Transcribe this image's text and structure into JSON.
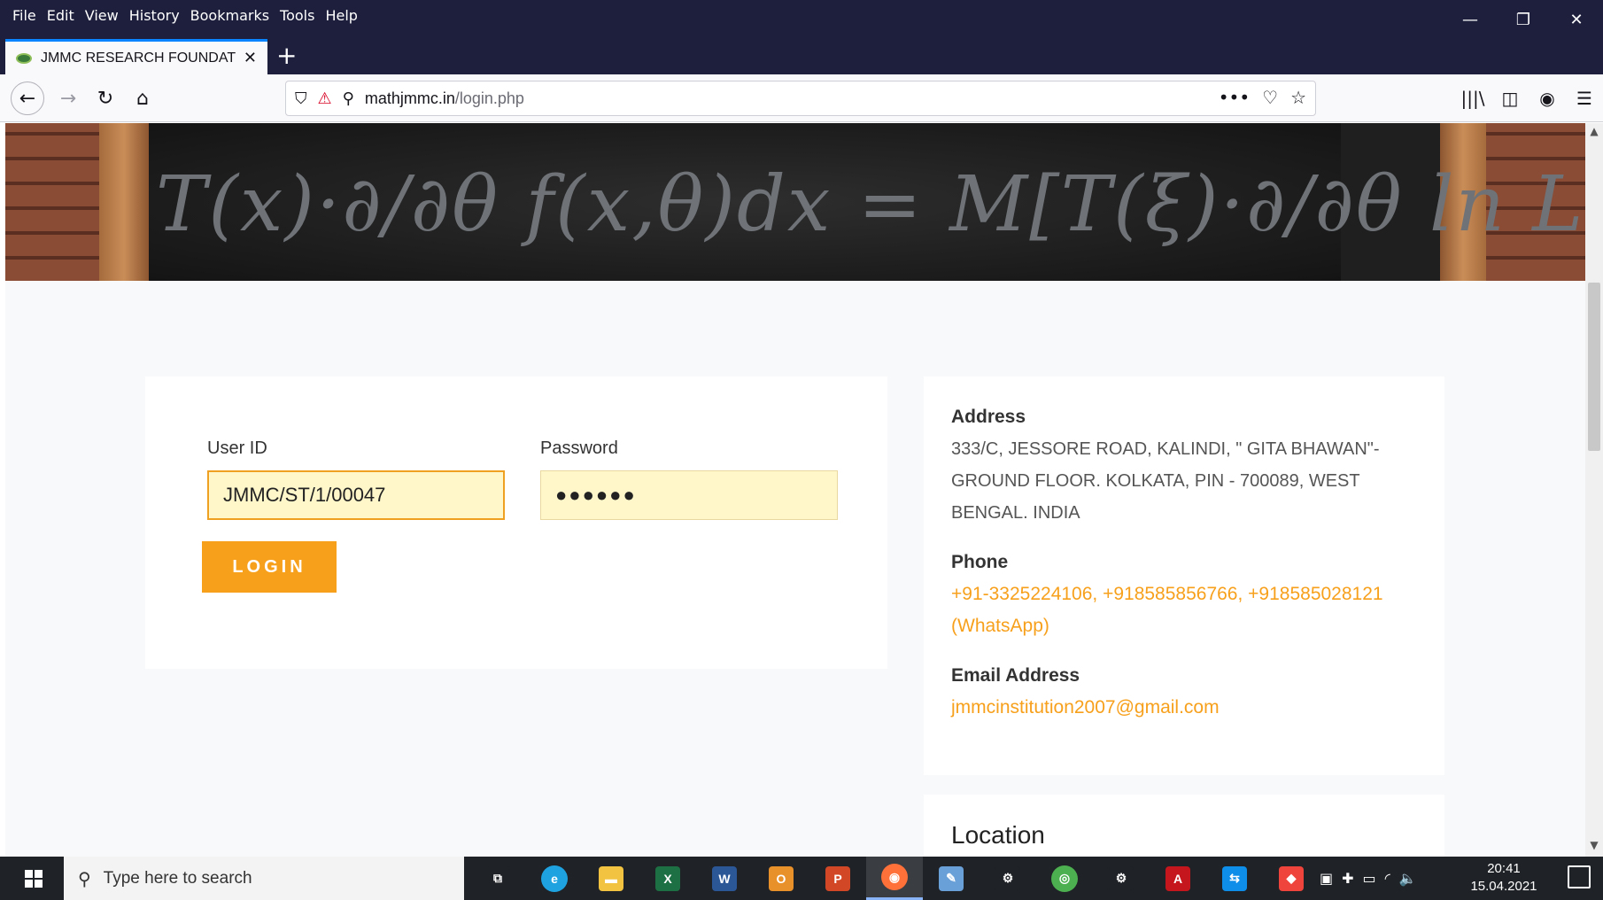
{
  "menu": [
    "File",
    "Edit",
    "View",
    "History",
    "Bookmarks",
    "Tools",
    "Help"
  ],
  "window_controls": {
    "minimize": "—",
    "restore": "❐",
    "close": "✕"
  },
  "tab": {
    "title": "JMMC RESEARCH FOUNDATIO",
    "close": "✕",
    "new_tab": "+"
  },
  "nav": {
    "back": "←",
    "forward": "→",
    "reload": "↻",
    "home": "⌂"
  },
  "url": {
    "host": "mathjmmc.in",
    "path": "/login.php",
    "shield": "⛉",
    "permissions": "⚲",
    "more": "•••",
    "pocket": "♡",
    "bookmark": "☆"
  },
  "toolbar_right": {
    "library": "|||\\",
    "sidebar": "◫",
    "account": "◉",
    "menu": "☰"
  },
  "banner": {
    "formula": "T(x)·∂/∂θ f(x,θ)dx = M[T(ξ)·∂/∂θ ln L(ξ,θ)]"
  },
  "login": {
    "user_label": "User ID",
    "user_value": "JMMC/ST/1/00047",
    "password_label": "Password",
    "password_value": "●●●●●●",
    "button": "LOGIN"
  },
  "contact": {
    "address_heading": "Address",
    "address": "333/C, JESSORE ROAD, KALINDI, \" GITA BHAWAN\"- GROUND FLOOR. KOLKATA, PIN - 700089, WEST BENGAL. INDIA",
    "phone_heading": "Phone",
    "phone": "+91-3325224106, +918585856766, +918585028121 (WhatsApp)",
    "email_heading": "Email Address",
    "email": "jmmcinstitution2007@gmail.com"
  },
  "location_heading": "Location",
  "scroll": {
    "up": "▲",
    "down": "▼"
  },
  "taskbar": {
    "search_placeholder": "Type here to search",
    "search_icon": "⚲",
    "time": "20:41",
    "date": "15.04.2021",
    "apps": [
      {
        "name": "task-view",
        "glyph": "⧉",
        "color": "#1f2226"
      },
      {
        "name": "edge",
        "glyph": "e",
        "color": "#1fa3e0"
      },
      {
        "name": "file-explorer",
        "glyph": "▬",
        "color": "#f2c340"
      },
      {
        "name": "excel",
        "glyph": "X",
        "color": "#1d7044"
      },
      {
        "name": "word",
        "glyph": "W",
        "color": "#2b5797"
      },
      {
        "name": "outlook",
        "glyph": "O",
        "color": "#e8902a"
      },
      {
        "name": "powerpoint",
        "glyph": "P",
        "color": "#d24726"
      },
      {
        "name": "firefox",
        "glyph": "◉",
        "color": "#ff7139"
      },
      {
        "name": "paint",
        "glyph": "✎",
        "color": "#6aa0d8"
      },
      {
        "name": "settings",
        "glyph": "⚙",
        "color": "#1f2226"
      },
      {
        "name": "chrome",
        "glyph": "◎",
        "color": "#4caf50"
      },
      {
        "name": "control",
        "glyph": "⚙",
        "color": "#1f2226"
      },
      {
        "name": "acrobat",
        "glyph": "A",
        "color": "#c4161c"
      },
      {
        "name": "teamviewer",
        "glyph": "⇆",
        "color": "#0e8ee9"
      },
      {
        "name": "anydesk",
        "glyph": "◆",
        "color": "#ef443b"
      }
    ],
    "tray": [
      "▣",
      "✚",
      "▭",
      "◜",
      "🔈"
    ]
  }
}
